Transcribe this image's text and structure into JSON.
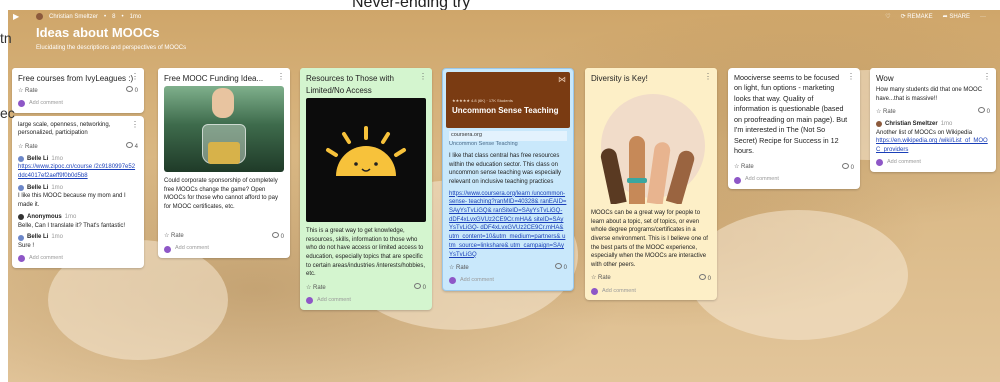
{
  "background": {
    "never_text": "Never-ending try",
    "left_fragment_1": "tn",
    "left_fragment_2": "ec"
  },
  "board": {
    "breadcrumb_author": "Christian Smeltzer",
    "breadcrumb_count": "8",
    "breadcrumb_time": "1mo",
    "title": "Ideas about MOOCs",
    "subtitle": "Elucidating the descriptions and perspectives of MOOCs",
    "actions": {
      "heart": "♡",
      "remake": "REMAKE",
      "share": "SHARE",
      "more": "···"
    }
  },
  "common": {
    "rate": "Rate",
    "add_comment": "Add comment",
    "comment_count": "0"
  },
  "columns": [
    {
      "title": "Free courses from IvyLeagues :)",
      "color": "#ffffff",
      "card1_comment_count": "0",
      "card2_text": "large scale, openness, networking, personalized, participation",
      "card2_comment_count": "4",
      "comments": [
        {
          "name": "Belle Li",
          "time": "1mo",
          "text": "https://www.zipoc.cn/course /2c9180997e52ddc4017ef2aeff9f0b0d5b8"
        },
        {
          "name": "Belle Li",
          "time": "1mo",
          "text": "I like this MOOC because my mom and I made it."
        },
        {
          "name": "Anonymous",
          "time": "1mo",
          "text": "Belle, Can I translate it? That's fantastic!"
        },
        {
          "name": "Belle Li",
          "time": "1mo",
          "text": "Sure !"
        }
      ]
    },
    {
      "title": "Free MOOC Funding Idea...",
      "color": "#ffffff",
      "text": "Could corporate sponsorship of completely free MOOCs change the game? Open MOOCs for those who cannot afford to pay for MOOC certificates, etc.",
      "comment_count": "0"
    },
    {
      "title": "Resources to Those with Limited/No Access",
      "color": "#d4f5cf",
      "text": "This is a great way to get knowledge, resources, skills, information to those who who do not have access or limited access to education, especially topics that are specific to certain areas/industries /interests/hobbies, etc.",
      "comment_count": "0"
    },
    {
      "title": "Uncommon Sense Teaching",
      "color": "#c9e8fb",
      "banner_meta": "★★★★★ 4.8 (6K) · 17K Students",
      "banner_title": "Uncommon Sense Teaching",
      "site": "coursera.org",
      "site_title": "Uncommon Sense Teaching",
      "text": "I like that class central has free resources within the education sector. This class on uncommon sense teaching was especially relevant on inclusive teaching practices",
      "link": "https://www.coursera.org/learn /uncommon-sense- teaching?ranMID=40328& ranEAID=SAyYsTvLiGQ& ranSiteID=SAyYsTvLiGQ- dDF4xLvxGVUz2CE9Cr.mHA& siteID=SAyYsTvLiGQ- dDF4xLvxGVUz2CE9Cr.mHA& utm_content=10&utm_medium=partners& utm_source=linkshare& utm_campaign=SAyYsTvLiGQ",
      "comment_count": "0"
    },
    {
      "title": "Diversity is Key!",
      "color": "#fdefc7",
      "text": "MOOCs can be a great way for people to learn about a topic, set of topics, or even whole degree programs/certificates in a diverse environment. This is I believe one of the best parts of the MOOC experience, especially when the MOOCs are interactive with other peers.",
      "comment_count": "0"
    },
    {
      "title": "Mooc­iverse seems to be focused on light, fun options - marketing looks that way. Quality of information is questionable (based on proofreading on main page). But I'm interested in The (Not So Secret) Recipe for Success in 12 hours.",
      "color": "#ffffff",
      "comment_count": "0"
    },
    {
      "title": "Wow",
      "color": "#ffffff",
      "text": "How many students did that one MOOC have...that is massive!!",
      "comment_name": "Christian Smeltzer",
      "comment_time": "1mo",
      "comment_text": "Another list of MOOCs on Wikipedia",
      "comment_link": "https://en.wikipedia.org /wiki/List_of_MOOC_providers",
      "comment_count": "0"
    }
  ]
}
